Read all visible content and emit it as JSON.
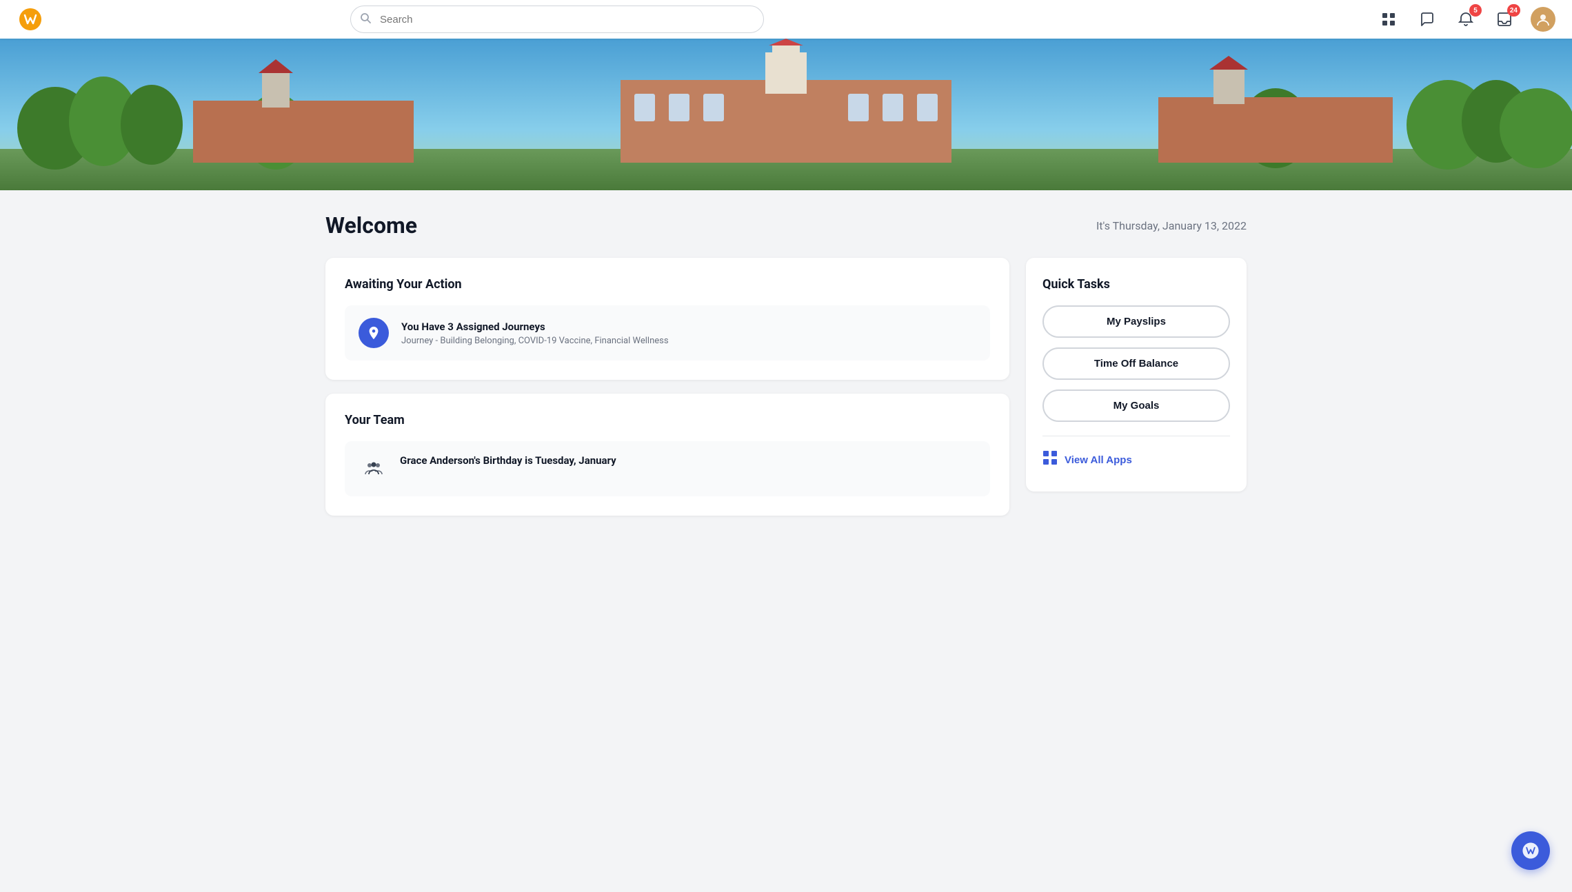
{
  "navbar": {
    "logo_alt": "Workday Logo",
    "search_placeholder": "Search",
    "notifications_count": "5",
    "inbox_count": "24"
  },
  "banner": {
    "alt": "University campus aerial photo"
  },
  "page": {
    "title": "Welcome",
    "date": "It's Thursday, January 13, 2022"
  },
  "awaiting_action": {
    "section_title": "Awaiting Your Action",
    "item_title": "You Have 3 Assigned Journeys",
    "item_subtitle": "Journey - Building Belonging, COVID-19 Vaccine, Financial Wellness"
  },
  "your_team": {
    "section_title": "Your Team",
    "item_title": "Grace Anderson's Birthday is Tuesday, January"
  },
  "quick_tasks": {
    "section_title": "Quick Tasks",
    "btn1": "My Payslips",
    "btn2": "Time Off Balance",
    "btn3": "My Goals",
    "view_all": "View All Apps"
  },
  "fab": {
    "label": "W"
  }
}
